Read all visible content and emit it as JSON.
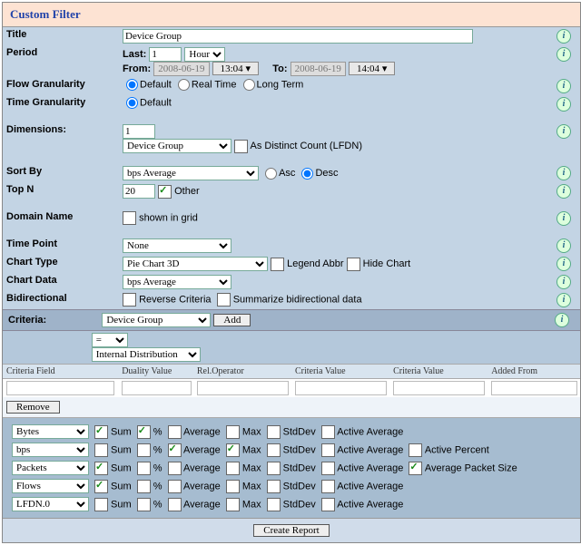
{
  "header": "Custom Filter",
  "labels": {
    "title": "Title",
    "period": "Period",
    "last": "Last:",
    "from": "From:",
    "to": "To:",
    "flowg": "Flow Granularity",
    "timeg": "Time Granularity",
    "dim": "Dimensions:",
    "distinct": "As Distinct Count (LFDN)",
    "sortby": "Sort By",
    "asc": "Asc",
    "desc": "Desc",
    "topn": "Top N",
    "other": "Other",
    "domain": "Domain Name",
    "shown": "shown in grid",
    "tp": "Time Point",
    "ct": "Chart Type",
    "legend": "Legend Abbr",
    "hide": "Hide Chart",
    "cd": "Chart Data",
    "bd": "Bidirectional",
    "rev": "Reverse Criteria",
    "summ": "Summarize bidirectional data",
    "criteria": "Criteria:",
    "add": "Add",
    "remove": "Remove",
    "create": "Create Report"
  },
  "title_val": "Device Group",
  "period": {
    "last_n": "1",
    "last_unit": "Hour",
    "from_date": "2008-06-19",
    "from_time": "13:04",
    "to_date": "2008-06-19",
    "to_time": "14:04"
  },
  "flowg": {
    "opts": [
      "Default",
      "Real Time",
      "Long Term"
    ],
    "sel": "Default"
  },
  "timeg": {
    "opts": [
      "Default"
    ],
    "sel": "Default"
  },
  "dim": {
    "n": "1",
    "sel": "Device Group",
    "distinct": false
  },
  "sort": {
    "sel": "bps Average",
    "dir": "Desc"
  },
  "topn": {
    "n": "20",
    "other": true
  },
  "domain_shown": false,
  "tp": "None",
  "ct": "Pie Chart 3D",
  "legend": false,
  "hide": false,
  "cd": "bps Average",
  "rev": false,
  "summ": false,
  "crit_field": "Device Group",
  "crit_op": "=",
  "crit_val": "Internal Distribution",
  "cols": {
    "c1": "Criteria Field",
    "c2": "Duality Value",
    "c3": "Rel.Operator",
    "c4": "Criteria Value",
    "c5": "Criteria Value",
    "c6": "Added From"
  },
  "st": {
    "h": {
      "sum": "Sum",
      "pct": "%",
      "avg": "Average",
      "max": "Max",
      "std": "StdDev",
      "aa": "Active Average",
      "ap": "Active Percent",
      "aps": "Average Packet Size"
    },
    "rows": [
      {
        "sel": "Bytes",
        "sum": true,
        "pct": true,
        "avg": false,
        "max": false,
        "std": false,
        "aa": false,
        "extra": null
      },
      {
        "sel": "bps",
        "sum": false,
        "pct": false,
        "avg": true,
        "max": true,
        "std": false,
        "aa": false,
        "extra": {
          "k": "ap",
          "v": false
        }
      },
      {
        "sel": "Packets",
        "sum": true,
        "pct": false,
        "avg": false,
        "max": false,
        "std": false,
        "aa": false,
        "extra": {
          "k": "aps",
          "v": true
        }
      },
      {
        "sel": "Flows",
        "sum": true,
        "pct": false,
        "avg": false,
        "max": false,
        "std": false,
        "aa": false,
        "extra": null
      },
      {
        "sel": "LFDN.0",
        "sum": false,
        "pct": false,
        "avg": false,
        "max": false,
        "std": false,
        "aa": false,
        "extra": null
      }
    ]
  }
}
